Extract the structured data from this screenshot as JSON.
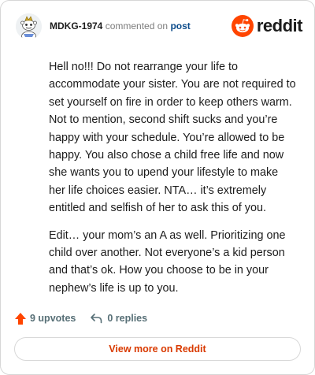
{
  "header": {
    "author": "MDKG-1974",
    "action_text": "commented on",
    "post_link": "post",
    "brand_name": "reddit",
    "avatar_icon": "snoo-avatar-icon",
    "brand_icon": "reddit-snoo-icon"
  },
  "comment": {
    "paragraphs": [
      "Hell no!!! Do not rearrange your life to accommodate your sister. You are not required to set yourself on fire in order to keep others warm. Not to mention, second shift sucks and you’re happy with your schedule. You’re allowed to be happy. You also chose a child free life and now she wants you to upend your lifestyle to make her life choices easier. NTA… it’s extremely entitled and selfish of her to ask this of you.",
      "Edit… your mom’s an A as well. Prioritizing one child over another. Not everyone’s a kid person and that’s ok. How you choose to be in your nephew’s life is up to you."
    ]
  },
  "footer": {
    "upvotes": "9 upvotes",
    "replies": "0 replies",
    "upvote_icon": "upvote-arrow-icon",
    "reply_icon": "reply-arrow-icon"
  },
  "cta": {
    "label": "View more on Reddit"
  },
  "colors": {
    "accent": "#ff4500",
    "link": "#0a4a8a",
    "cta_text": "#d93a00",
    "muted": "#576f76",
    "border": "#d6d6d6"
  }
}
